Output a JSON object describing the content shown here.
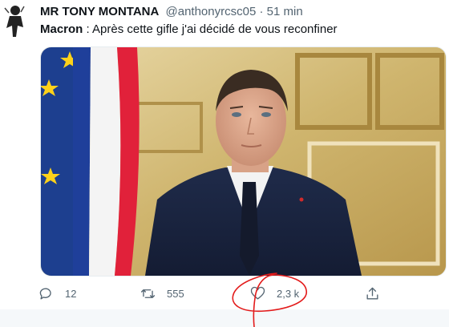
{
  "tweet": {
    "display_name": "MR TONY MONTANA",
    "handle": "@anthonyrcsc05",
    "separator": "·",
    "time": "51 min",
    "text_bold": "Macron",
    "text_rest": " : Après cette gifle j'ai décidé de vous reconfiner"
  },
  "actions": {
    "reply_count": "12",
    "retweet_count": "555",
    "like_count": "2,3 k"
  },
  "icons": {
    "reply": "reply-icon",
    "retweet": "retweet-icon",
    "like": "heart-icon",
    "share": "share-icon"
  },
  "colors": {
    "text_primary": "#0f1419",
    "text_secondary": "#536471",
    "annotation_red": "#e31b1b",
    "flag_blue": "#1f3f9a",
    "flag_red": "#e1213a",
    "eu_blue": "#1d3f8f",
    "eu_star": "#ffd21a"
  }
}
